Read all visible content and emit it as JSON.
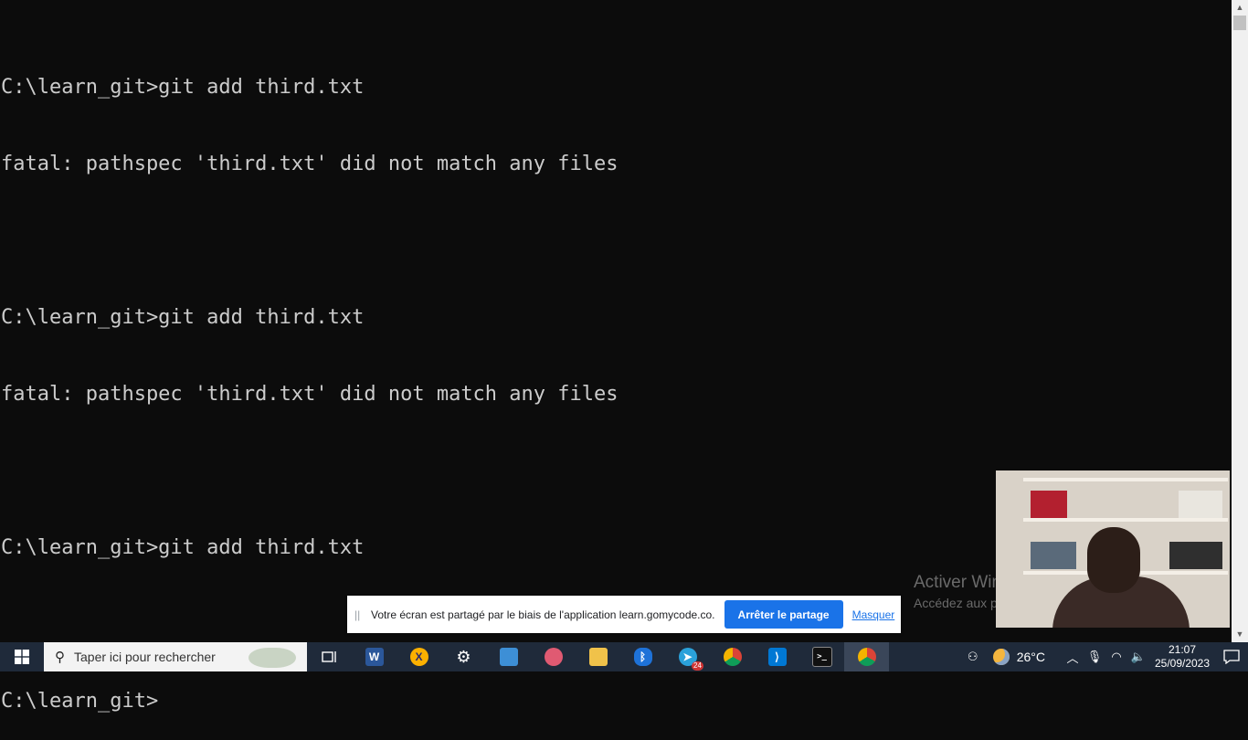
{
  "terminal": {
    "lines": [
      "C:\\learn_git>git add third.txt",
      "fatal: pathspec 'third.txt' did not match any files",
      "",
      "C:\\learn_git>git add third.txt",
      "fatal: pathspec 'third.txt' did not match any files",
      "",
      "C:\\learn_git>git add third.txt",
      "",
      "C:\\learn_git>"
    ]
  },
  "watermark": {
    "title": "Activer Windows",
    "subtitle": "Accédez aux paramètres pour activer Windows."
  },
  "share_bar": {
    "message": "Votre écran est partagé par le biais de l'application learn.gomycode.co.",
    "stop_label": "Arrêter le partage",
    "hide_label": "Masquer"
  },
  "taskbar": {
    "search_placeholder": "Taper ici pour rechercher",
    "apps": [
      {
        "icon": "task-view-icon",
        "label": ""
      },
      {
        "icon": "word-icon",
        "label": "W"
      },
      {
        "icon": "xampp-icon",
        "label": "X"
      },
      {
        "icon": "settings-icon",
        "label": "⚙"
      },
      {
        "icon": "remote-desktop-icon",
        "label": ""
      },
      {
        "icon": "paint-icon",
        "label": ""
      },
      {
        "icon": "file-explorer-icon",
        "label": ""
      },
      {
        "icon": "bluetooth-icon",
        "label": "ᛒ"
      },
      {
        "icon": "telegram-icon",
        "label": "➤",
        "badge": "24"
      },
      {
        "icon": "chrome-profile-icon",
        "label": ""
      },
      {
        "icon": "vscode-icon",
        "label": "⟩"
      },
      {
        "icon": "terminal-icon",
        "label": ">_"
      },
      {
        "icon": "chrome-icon",
        "label": ""
      }
    ],
    "weather_temp": "26°C",
    "time": "21:07",
    "date": "25/09/2023"
  },
  "colors": {
    "terminal_bg": "#0c0c0c",
    "terminal_fg": "#cccccc",
    "taskbar_bg": "#1f2a3a",
    "share_button": "#1a73e8"
  }
}
